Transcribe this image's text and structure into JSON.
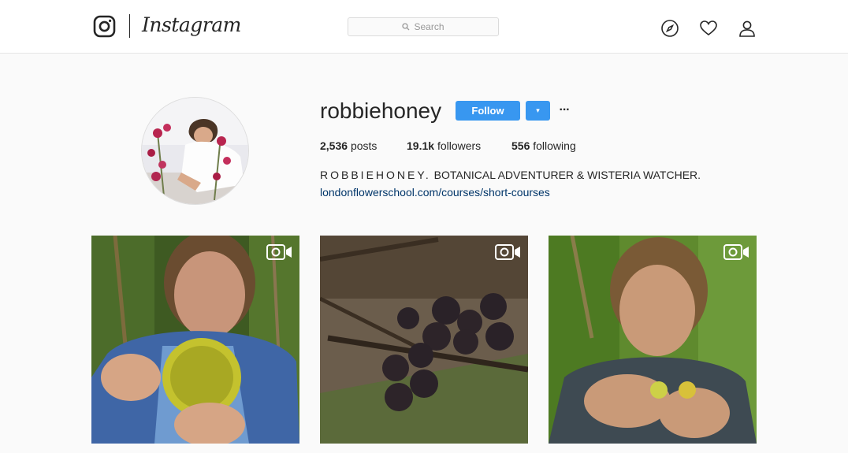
{
  "header": {
    "wordmark": "Instagram",
    "search_placeholder": "Search",
    "icons": [
      "instagram-logo-icon",
      "explore-compass-icon",
      "activity-heart-icon",
      "profile-person-icon"
    ]
  },
  "profile": {
    "username": "robbiehoney",
    "follow_label": "Follow",
    "dropdown_label": "▾",
    "more_label": "···",
    "posts_count": "2,536",
    "posts_label": "posts",
    "followers_count": "19.1k",
    "followers_label": "followers",
    "following_count": "556",
    "following_label": "following",
    "bio_name": "ROBBIEHONEY.",
    "bio_text": "BOTANICAL ADVENTURER & WISTERIA WATCHER.",
    "bio_link": "londonflowerschool.com/courses/short-courses"
  },
  "posts": [
    {
      "type": "video",
      "subject": "man holding spiky green fruit in forest"
    },
    {
      "type": "video",
      "subject": "dark berries on wet log"
    },
    {
      "type": "video",
      "subject": "man holding small yellow fruit in jungle"
    }
  ],
  "colors": {
    "accent": "#3897f0",
    "link": "#003569",
    "background": "#fafafa"
  }
}
